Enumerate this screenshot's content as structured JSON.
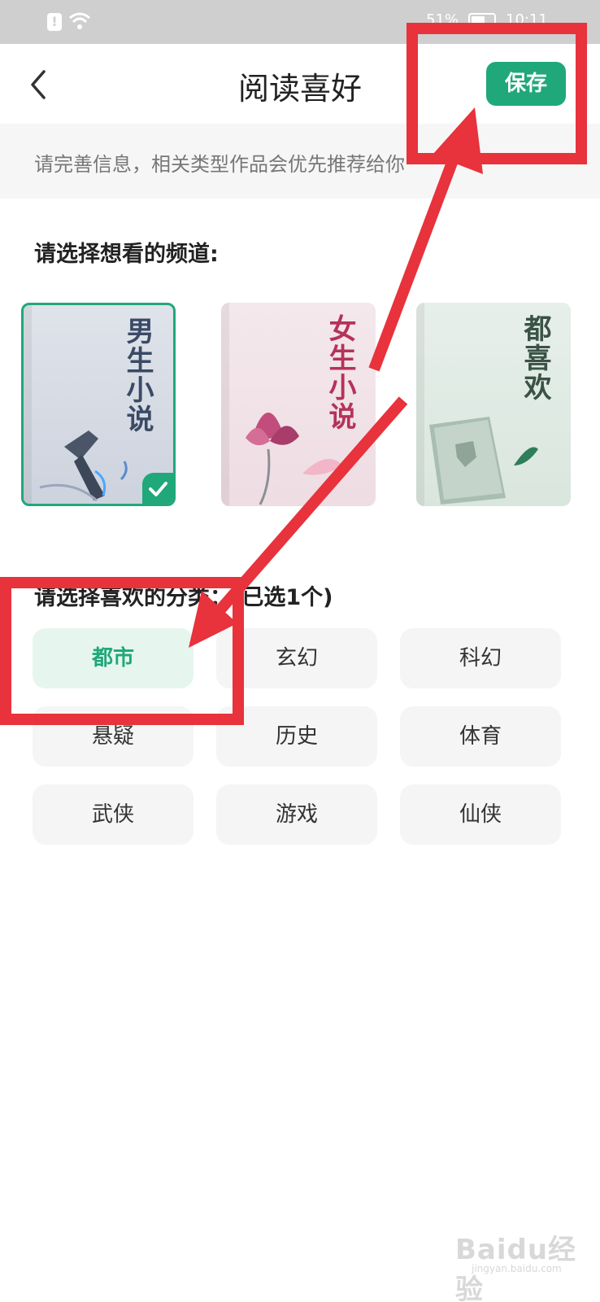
{
  "status_bar": {
    "battery": "51%",
    "time": "10:11"
  },
  "nav": {
    "title": "阅读喜好",
    "save_label": "保存"
  },
  "info_banner": {
    "text": "请完善信息，相关类型作品会优先推荐给你"
  },
  "channels": {
    "heading": "请选择想看的频道:",
    "items": [
      {
        "label": "男生小说",
        "selected": true,
        "color": "#3a4a66"
      },
      {
        "label": "女生小说",
        "selected": false,
        "color": "#b5325a"
      },
      {
        "label": "都喜欢",
        "selected": false,
        "color": "#3b5247"
      }
    ]
  },
  "categories": {
    "heading": "请选择喜欢的分类：(已选1个)",
    "items": [
      "都市",
      "玄幻",
      "科幻",
      "悬疑",
      "历史",
      "体育",
      "武侠",
      "游戏",
      "仙侠"
    ],
    "selected": "都市"
  },
  "watermark": {
    "logo": "Baidu经验",
    "url": "jingyan.baidu.com"
  },
  "colors": {
    "accent": "#20a87a",
    "annotation": "#e8323c"
  }
}
